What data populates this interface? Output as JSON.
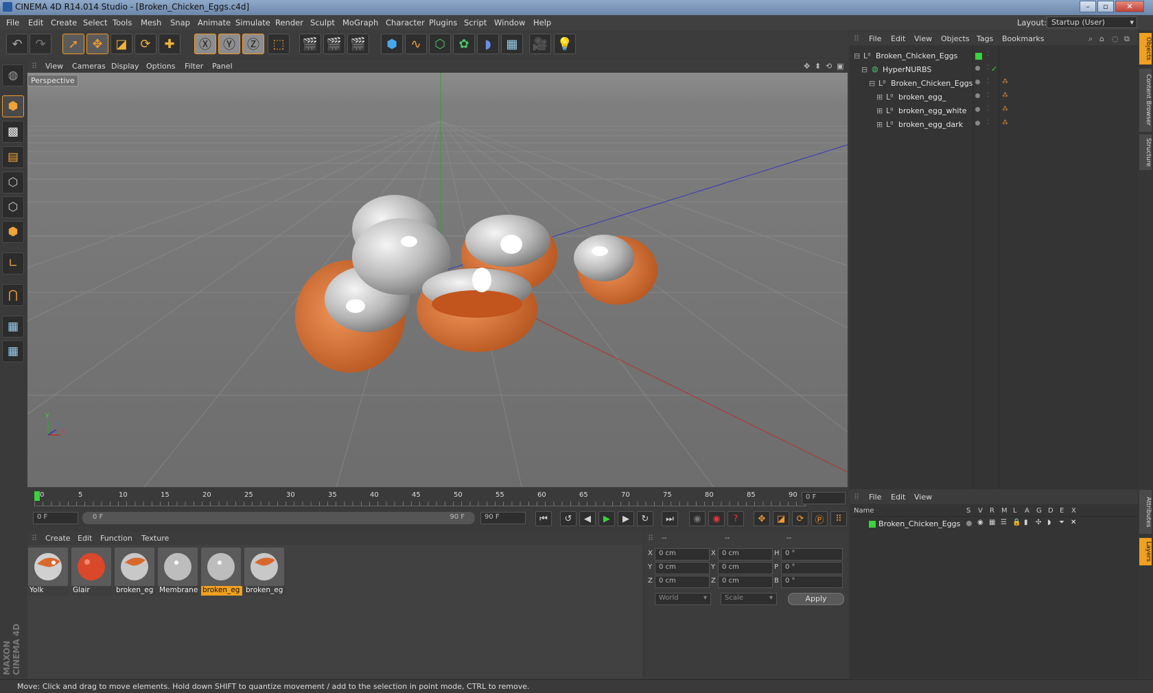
{
  "window": {
    "title": "CINEMA 4D R14.014 Studio - [Broken_Chicken_Eggs.c4d]"
  },
  "menubar": [
    "File",
    "Edit",
    "Create",
    "Select",
    "Tools",
    "Mesh",
    "Snap",
    "Animate",
    "Simulate",
    "Render",
    "Sculpt",
    "MoGraph",
    "Character",
    "Plugins",
    "Script",
    "Window",
    "Help"
  ],
  "layout": {
    "label": "Layout:",
    "value": "Startup (User)"
  },
  "viewport": {
    "menu": [
      "View",
      "Cameras",
      "Display",
      "Options",
      "Filter",
      "Panel"
    ],
    "camera_label": "Perspective",
    "axis_labels": {
      "y": "Y",
      "x": "X",
      "z": "Z"
    }
  },
  "timeline": {
    "ticks": [
      "0",
      "5",
      "10",
      "15",
      "20",
      "25",
      "30",
      "35",
      "40",
      "45",
      "50",
      "55",
      "60",
      "65",
      "70",
      "75",
      "80",
      "85",
      "90"
    ],
    "frame_field": "0 F"
  },
  "transport": {
    "current": "0 F",
    "range_start": "0 F",
    "range_end": "90 F",
    "end_field": "90 F"
  },
  "materials": {
    "menu": [
      "Create",
      "Edit",
      "Function",
      "Texture"
    ],
    "items": [
      {
        "label": "Yolk",
        "color": "#d9682c"
      },
      {
        "label": "Glair",
        "color": "#d9482a"
      },
      {
        "label": "broken_eg",
        "color": "#d9682c"
      },
      {
        "label": "Membrane",
        "color": "#c8c8c8"
      },
      {
        "label": "broken_eg",
        "color": "#c8c8c8",
        "selected": true
      },
      {
        "label": "broken_eg",
        "color": "#d9682c"
      }
    ]
  },
  "coordinates": {
    "headers": [
      "--",
      "--",
      "--"
    ],
    "rows": [
      {
        "a": "X",
        "av": "0 cm",
        "b": "X",
        "bv": "0 cm",
        "c": "H",
        "cv": "0 °"
      },
      {
        "a": "Y",
        "av": "0 cm",
        "b": "Y",
        "bv": "0 cm",
        "c": "P",
        "cv": "0 °"
      },
      {
        "a": "Z",
        "av": "0 cm",
        "b": "Z",
        "bv": "0 cm",
        "c": "B",
        "cv": "0 °"
      }
    ],
    "space": "World",
    "mode": "Scale",
    "apply": "Apply"
  },
  "objects": {
    "menu": [
      "File",
      "Edit",
      "View",
      "Objects",
      "Tags",
      "Bookmarks"
    ],
    "tree": [
      {
        "name": "Broken_Chicken_Eggs",
        "depth": 0
      },
      {
        "name": "HyperNURBS",
        "depth": 1
      },
      {
        "name": "Broken_Chicken_Eggs",
        "depth": 2
      },
      {
        "name": "broken_egg_",
        "depth": 3
      },
      {
        "name": "broken_egg_white",
        "depth": 3
      },
      {
        "name": "broken_egg_dark",
        "depth": 3
      }
    ]
  },
  "layers": {
    "menu": [
      "File",
      "Edit",
      "View"
    ],
    "columns": [
      "Name",
      "S",
      "V",
      "R",
      "M",
      "L",
      "A",
      "G",
      "D",
      "E",
      "X"
    ],
    "rows": [
      {
        "name": "Broken_Chicken_Eggs",
        "color": "#33cc33"
      }
    ]
  },
  "side_tabs": [
    "Objects",
    "Content Browser",
    "Structure",
    "Attributes",
    "Layers"
  ],
  "branding": "MAXON CINEMA 4D",
  "status": "Move: Click and drag to move elements. Hold down SHIFT to quantize movement / add to the selection in point mode, CTRL to remove."
}
